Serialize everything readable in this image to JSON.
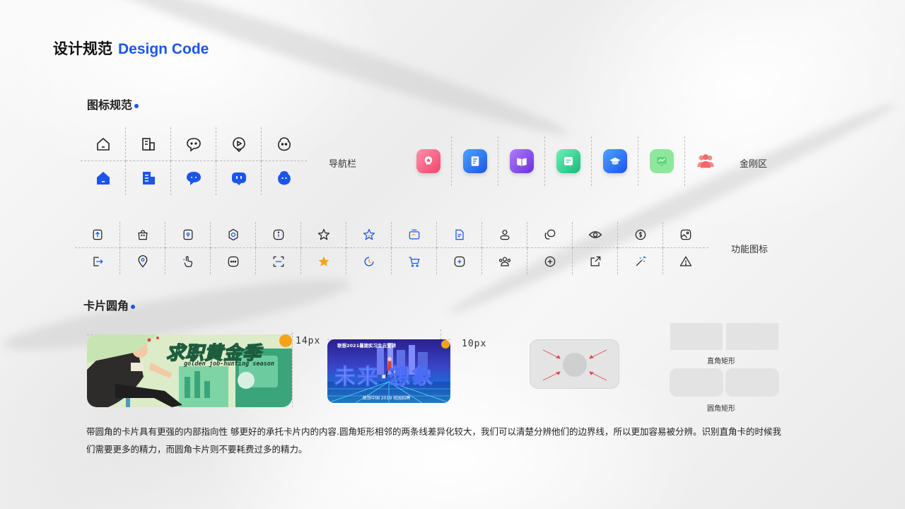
{
  "title": {
    "cn": "设计规范",
    "en": "Design Code"
  },
  "sections": {
    "icons": "图标规范",
    "cards": "卡片圆角"
  },
  "labels": {
    "nav": "导航栏",
    "jingang": "金刚区",
    "function": "功能图标",
    "px14": "14px",
    "px10": "10px",
    "square_rect": "直角矩形",
    "round_rect": "圆角矩形"
  },
  "nav_icons": [
    "home-icon",
    "building-icon",
    "chat-bubble-icon",
    "video-chat-icon",
    "bot-face-icon"
  ],
  "jingang_icons": [
    {
      "name": "badge-icon",
      "color": "#f05a7e"
    },
    {
      "name": "document-icon",
      "color": "#1a6fe8"
    },
    {
      "name": "book-icon",
      "color": "#8a4be8"
    },
    {
      "name": "card-icon",
      "color": "#2fcf90"
    },
    {
      "name": "graduation-cap-icon",
      "color": "#1a6fe8"
    },
    {
      "name": "monitor-chart-icon",
      "color": "#5fd67b"
    },
    {
      "name": "people-icon",
      "color": "#f07070"
    }
  ],
  "card1": {
    "headline": "求职黄金季",
    "sub": "golden job-hunting season"
  },
  "card2": {
    "top": "联想2021暑期实习生云宣讲",
    "big": "未来·想象",
    "bottom": "联想中国 2019 校园招聘"
  },
  "description": "带圆角的卡片具有更强的内部指向性 够更好的承托卡片内的内容.圆角矩形相邻的两条线差异化较大，我们可以清楚分辨他们的边界线，所以更加容易被分辨。识别直角卡的时候我们需要更多的精力，而圆角卡片则不要耗费过多的精力。",
  "colors": {
    "accent": "#1a56e8",
    "orange": "#f5a31a"
  }
}
